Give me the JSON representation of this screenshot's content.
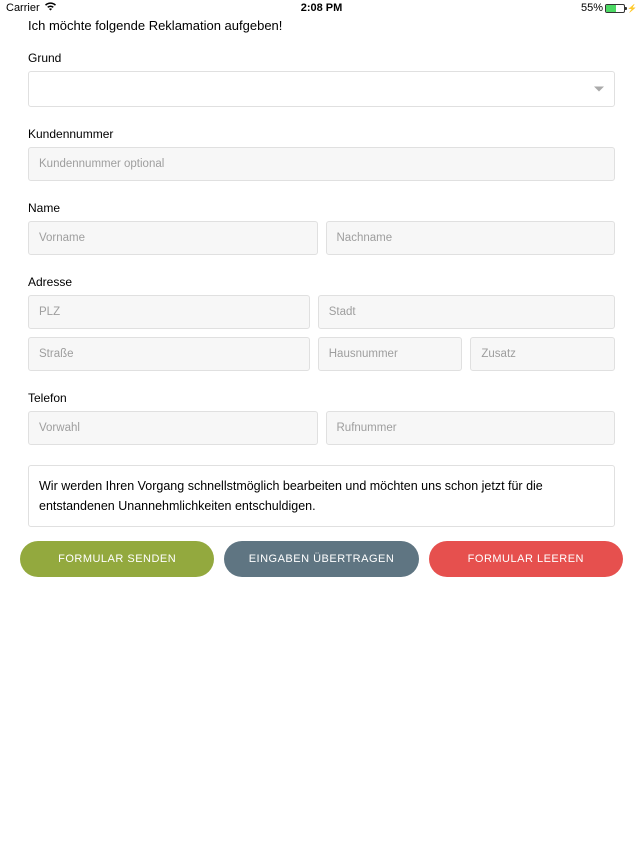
{
  "status": {
    "carrier": "Carrier",
    "time": "2:08 PM",
    "battery_pct": "55%"
  },
  "form": {
    "intro": "Ich möchte folgende Reklamation aufgeben!",
    "reason": {
      "label": "Grund"
    },
    "customerNumber": {
      "label": "Kundennummer",
      "placeholder": "Kundennummer optional"
    },
    "name": {
      "label": "Name",
      "first_placeholder": "Vorname",
      "last_placeholder": "Nachname"
    },
    "address": {
      "label": "Adresse",
      "plz_placeholder": "PLZ",
      "city_placeholder": "Stadt",
      "street_placeholder": "Straße",
      "houseno_placeholder": "Hausnummer",
      "extra_placeholder": "Zusatz"
    },
    "phone": {
      "label": "Telefon",
      "prefix_placeholder": "Vorwahl",
      "number_placeholder": "Rufnummer"
    },
    "note": "Wir werden Ihren Vorgang schnellstmöglich bearbeiten und möchten uns schon jetzt für die entstandenen Unannehmlichkeiten entschuldigen."
  },
  "buttons": {
    "send": "FORMULAR SENDEN",
    "transfer": "EINGABEN ÜBERTRAGEN",
    "clear": "FORMULAR LEEREN"
  }
}
